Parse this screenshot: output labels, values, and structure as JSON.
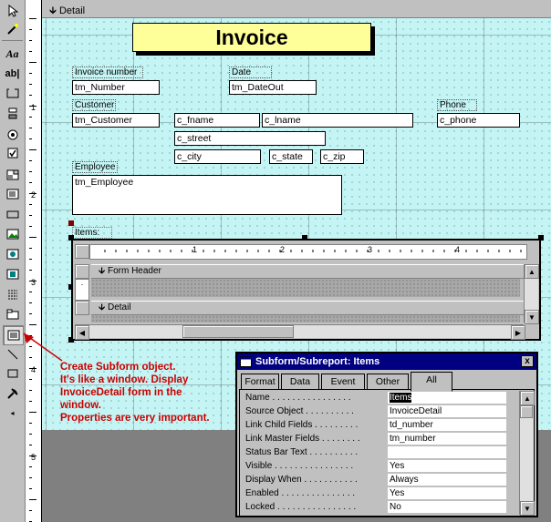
{
  "toolbox": {
    "tools": [
      "select-arrow-icon",
      "wizard-wand-icon",
      "label-aa-icon",
      "textbox-ab-icon",
      "option-group-icon",
      "toggle-button-icon",
      "option-button-icon",
      "checkbox-icon",
      "combo-box-icon",
      "list-box-icon",
      "command-button-icon",
      "image-icon",
      "unbound-object-icon",
      "bound-object-icon",
      "page-break-icon",
      "tab-control-icon",
      "subform-icon",
      "line-icon",
      "rectangle-icon",
      "more-tools-icon"
    ]
  },
  "ruler": {
    "marks": [
      "1",
      "2",
      "3",
      "4",
      "5"
    ]
  },
  "section": {
    "detail_label": "Detail"
  },
  "form": {
    "title": "Invoice",
    "labels": {
      "invoice_number": "Invoice number",
      "date": "Date",
      "customer": "Customer",
      "phone": "Phone",
      "employee": "Employee",
      "items": "Items:"
    },
    "fields": {
      "tm_number": "tm_Number",
      "tm_dateout": "tm_DateOut",
      "tm_customer": "tm_Customer",
      "c_fname": "c_fname",
      "c_lname": "c_lname",
      "c_phone": "c_phone",
      "c_street": "c_street",
      "c_city": "c_city",
      "c_state": "c_state",
      "c_zip": "c_zip",
      "tm_employee": "tm_Employee"
    }
  },
  "subform": {
    "ruler_numbers": [
      "1",
      "2",
      "3",
      "4"
    ],
    "form_header": "Form Header",
    "detail": "Detail"
  },
  "annotation": {
    "lines": [
      "Create Subform object.",
      "It's like a window. Display",
      "InvoiceDetail form in the",
      "window.",
      "Properties are very important."
    ],
    "color": "#cc0000"
  },
  "properties": {
    "title": "Subform/Subreport: Items",
    "close_label": "x",
    "tabs": [
      "Format",
      "Data",
      "Event",
      "Other",
      "All"
    ],
    "active_tab": "All",
    "rows": [
      {
        "name": "Name . . . . . . . . . . . . . . . .",
        "value": "Items"
      },
      {
        "name": "Source Object . . . . . . . . . .",
        "value": "InvoiceDetail"
      },
      {
        "name": "Link Child Fields . . . . . . . . .",
        "value": "td_number"
      },
      {
        "name": "Link Master Fields . . . . . . . .",
        "value": "tm_number"
      },
      {
        "name": "Status Bar Text . . . . . . . . . .",
        "value": ""
      },
      {
        "name": "Visible . . . . . . . . . . . . . . . .",
        "value": "Yes"
      },
      {
        "name": "Display When . . . . . . . . . . .",
        "value": "Always"
      },
      {
        "name": "Enabled . . . . . . . . . . . . . . .",
        "value": "Yes"
      },
      {
        "name": "Locked . . . . . . . . . . . . . . . .",
        "value": "No"
      }
    ]
  }
}
